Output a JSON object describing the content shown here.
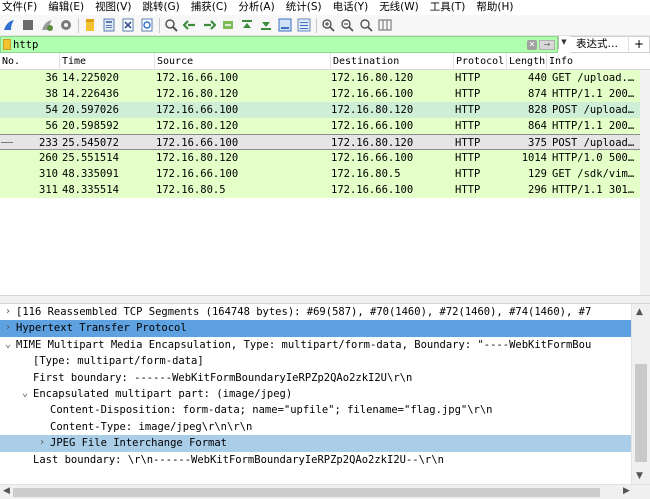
{
  "menu": [
    "文件(F)",
    "编辑(E)",
    "视图(V)",
    "跳转(G)",
    "捕获(C)",
    "分析(A)",
    "统计(S)",
    "电话(Y)",
    "无线(W)",
    "工具(T)",
    "帮助(H)"
  ],
  "toolbar": {
    "icons": [
      "shark-fin-start-icon",
      "stop-square-icon",
      "restart-icon",
      "options-gear-icon",
      "open-folder-icon",
      "save-file-icon",
      "close-file-icon",
      "reload-icon",
      "find-magnifier-icon",
      "go-back-arrow-icon",
      "go-forward-arrow-icon",
      "go-to-packet-icon",
      "first-packet-icon",
      "last-packet-icon",
      "autoscroll-icon",
      "colorize-icon",
      "zoom-in-icon",
      "zoom-out-icon",
      "zoom-normal-icon",
      "resize-columns-icon"
    ]
  },
  "filter": {
    "value": "http",
    "expression_label": "表达式…",
    "plus_label": "+",
    "bg_color": "#afffaf"
  },
  "packet_list": {
    "columns": [
      "No.",
      "Time",
      "Source",
      "Destination",
      "Protocol",
      "Length",
      "Info"
    ],
    "rows": [
      {
        "no": "36",
        "time": "14.225020",
        "src": "172.16.66.100",
        "dst": "172.16.80.120",
        "proto": "HTTP",
        "len": "440",
        "info": "GET /upload.…",
        "bg": "#e4ffc7"
      },
      {
        "no": "38",
        "time": "14.226436",
        "src": "172.16.80.120",
        "dst": "172.16.66.100",
        "proto": "HTTP",
        "len": "874",
        "info": "HTTP/1.1 200…",
        "bg": "#e4ffc7"
      },
      {
        "no": "54",
        "time": "20.597026",
        "src": "172.16.66.100",
        "dst": "172.16.80.120",
        "proto": "HTTP",
        "len": "828",
        "info": "POST /upload…",
        "bg": "#cfeed6"
      },
      {
        "no": "56",
        "time": "20.598592",
        "src": "172.16.80.120",
        "dst": "172.16.66.100",
        "proto": "HTTP",
        "len": "864",
        "info": "HTTP/1.1 200…",
        "bg": "#e4ffc7"
      },
      {
        "no": "233",
        "time": "25.545072",
        "src": "172.16.66.100",
        "dst": "172.16.80.120",
        "proto": "HTTP",
        "len": "375",
        "info": "POST /upload…",
        "bg": "#e5e5e5",
        "selected": true
      },
      {
        "no": "260",
        "time": "25.551514",
        "src": "172.16.80.120",
        "dst": "172.16.66.100",
        "proto": "HTTP",
        "len": "1014",
        "info": "HTTP/1.0 500…",
        "bg": "#e4ffc7"
      },
      {
        "no": "310",
        "time": "48.335091",
        "src": "172.16.66.100",
        "dst": "172.16.80.5",
        "proto": "HTTP",
        "len": "129",
        "info": "GET /sdk/vim…",
        "bg": "#e4ffc7"
      },
      {
        "no": "311",
        "time": "48.335514",
        "src": "172.16.80.5",
        "dst": "172.16.66.100",
        "proto": "HTTP",
        "len": "296",
        "info": "HTTP/1.1 301…",
        "bg": "#e4ffc7"
      }
    ]
  },
  "details": {
    "rows": [
      {
        "arrow": "›",
        "text": "[116 Reassembled TCP Segments (164748 bytes): #69(587), #70(1460), #72(1460), #74(1460), #7",
        "level": 0
      },
      {
        "arrow": "›",
        "text": "Hypertext Transfer Protocol",
        "level": 0,
        "highlight": "dark"
      },
      {
        "arrow": "⌄",
        "text": "MIME Multipart Media Encapsulation, Type: multipart/form-data, Boundary: \"----WebKitFormBou",
        "level": 0
      },
      {
        "arrow": "",
        "text": "[Type: multipart/form-data]",
        "level": 1
      },
      {
        "arrow": "",
        "text": "First boundary: ------WebKitFormBoundaryIeRPZp2QAo2zkI2U\\r\\n",
        "level": 1
      },
      {
        "arrow": "⌄",
        "text": "Encapsulated multipart part:  (image/jpeg)",
        "level": 1
      },
      {
        "arrow": "",
        "text": "Content-Disposition: form-data; name=\"upfile\"; filename=\"flag.jpg\"\\r\\n",
        "level": 2
      },
      {
        "arrow": "",
        "text": "Content-Type: image/jpeg\\r\\n\\r\\n",
        "level": 2
      },
      {
        "arrow": "›",
        "text": "JPEG File Interchange Format",
        "level": 2,
        "highlight": "light"
      },
      {
        "arrow": "",
        "text": "Last boundary: \\r\\n------WebKitFormBoundaryIeRPZp2QAo2zkI2U--\\r\\n",
        "level": 1
      }
    ]
  }
}
